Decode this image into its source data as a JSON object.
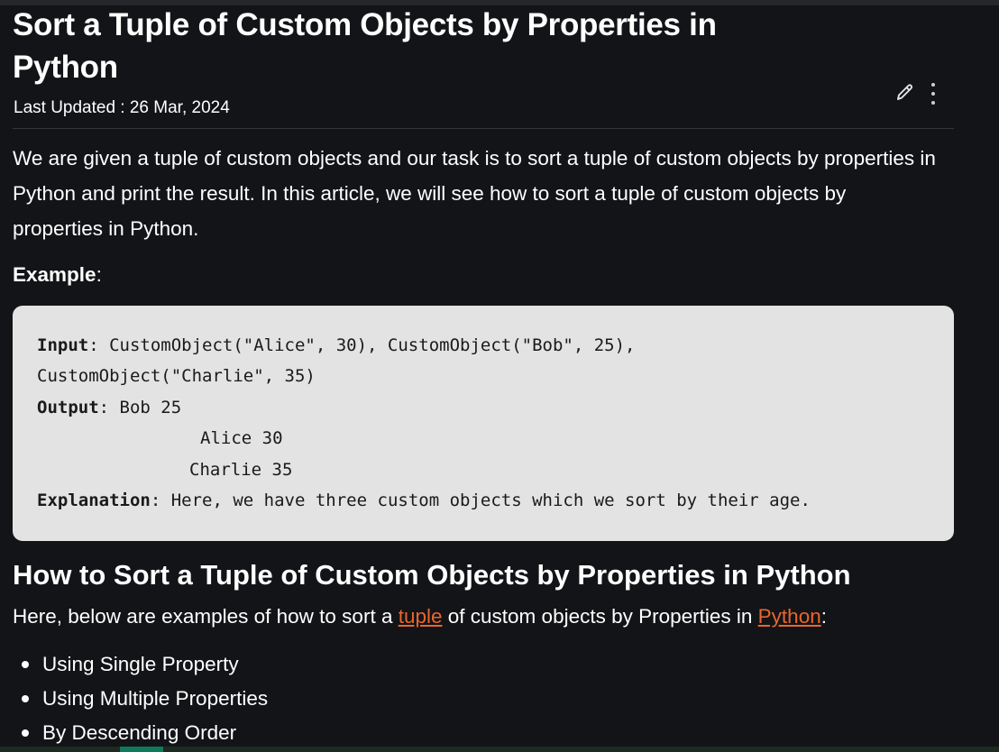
{
  "article": {
    "title": "Sort a Tuple of Custom Objects by Properties in Python",
    "last_updated": "Last Updated : 26 Mar, 2024",
    "toolbar": {
      "edit_icon": "pencil-icon",
      "more_icon": "more-vertical-icon"
    },
    "intro": "We are given a tuple of custom objects and our task is to sort a tuple of custom objects by properties in Python and print the result. In this article, we will see how to sort a tuple of custom objects by properties in Python.",
    "example_label": "Example",
    "example_colon": ":",
    "code": {
      "input_label": "Input",
      "input_line1": ": CustomObject(\"Alice\", 30), CustomObject(\"Bob\", 25),",
      "input_line2": "CustomObject(\"Charlie\", 35)",
      "output_label": "Output",
      "output_line1": ": Bob 25",
      "output_line2": "Alice 30",
      "output_line3": "Charlie 35",
      "explanation_label": "Explanation",
      "explanation_text": ": Here, we have three custom objects which we sort by their age."
    },
    "section_heading": "How to Sort a Tuple of Custom Objects by Properties in Python",
    "lead": {
      "before": "Here, below are examples of how to sort a ",
      "link1": "tuple",
      "middle": " of custom objects by Properties in ",
      "link2": "Python",
      "after": ":"
    },
    "methods": [
      "Using Single Property",
      "Using Multiple Properties",
      "By Descending Order"
    ],
    "colors": {
      "background": "#131417",
      "code_bg": "#e3e3e3",
      "link": "#e8662d",
      "accent": "#0f7a5a"
    }
  }
}
